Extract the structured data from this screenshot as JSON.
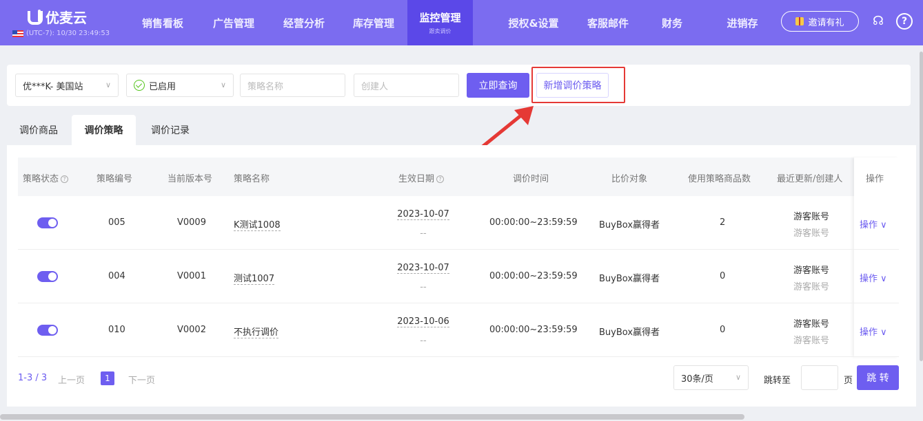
{
  "app": {
    "name": "优麦云",
    "region_time": "(UTC-7): 10/30 23:49:53"
  },
  "nav": {
    "items": [
      "销售看板",
      "广告管理",
      "经营分析",
      "库存管理",
      "监控管理",
      "授权&设置",
      "客服邮件",
      "财务",
      "进销存"
    ],
    "active_sub": "跟卖调价",
    "invite_label": "邀请有礼",
    "icons": [
      "support-icon",
      "help-icon"
    ]
  },
  "filter": {
    "store": "优***K- 美国站",
    "status": "已启用",
    "strategy_name_placeholder": "策略名称",
    "creator_placeholder": "创建人",
    "query_button": "立即查询",
    "new_button": "新增调价策略"
  },
  "tabs": [
    "调价商品",
    "调价策略",
    "调价记录"
  ],
  "table": {
    "headers": [
      "策略状态",
      "策略编号",
      "当前版本号",
      "策略名称",
      "生效日期",
      "调价时间",
      "比价对象",
      "使用策略商品数",
      "最近更新/创建人",
      "操作"
    ],
    "rows": [
      {
        "enabled": true,
        "id": "005",
        "version": "V0009",
        "name": "K测试1008",
        "date": "2023-10-07",
        "date_end": "--",
        "time": "00:00:00~23:59:59",
        "target": "BuyBox赢得者",
        "count": "2",
        "updater": "游客账号",
        "creator": "游客账号",
        "op": "操作"
      },
      {
        "enabled": true,
        "id": "004",
        "version": "V0001",
        "name": "测试1007",
        "date": "2023-10-07",
        "date_end": "--",
        "time": "00:00:00~23:59:59",
        "target": "BuyBox赢得者",
        "count": "0",
        "updater": "游客账号",
        "creator": "游客账号",
        "op": "操作"
      },
      {
        "enabled": true,
        "id": "010",
        "version": "V0002",
        "name": "不执行调价",
        "date": "2023-10-06",
        "date_end": "--",
        "time": "00:00:00~23:59:59",
        "target": "BuyBox赢得者",
        "count": "0",
        "updater": "游客账号",
        "creator": "游客账号",
        "op": "操作"
      }
    ]
  },
  "pagination": {
    "range": "1-3 / 3",
    "prev": "上一页",
    "current": "1",
    "next": "下一页",
    "page_size": "30条/页",
    "jump_label": "跳转至",
    "page_unit": "页",
    "jump_button": "跳 转"
  },
  "colors": {
    "brand": "#7b6cf0",
    "nav_active": "#5b48e8",
    "primary": "#6e5ef0",
    "highlight": "#e53935"
  }
}
